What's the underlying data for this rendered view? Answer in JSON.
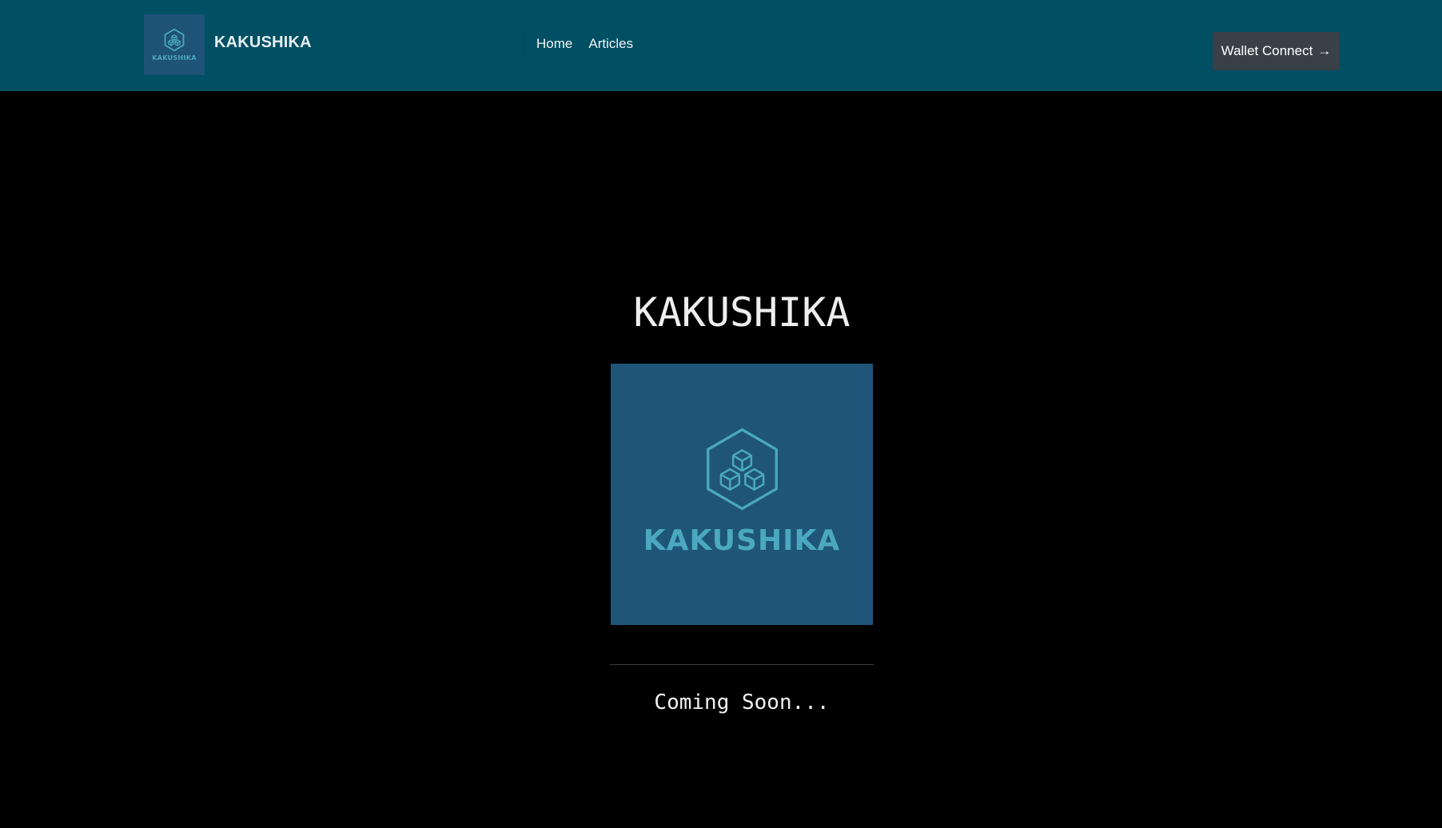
{
  "header": {
    "brand_name": "KAKUSHIKA",
    "logo_text": "KAKUSHIKA",
    "logo_icon": "hexagon-cubes-icon",
    "nav": [
      {
        "label": "Home"
      },
      {
        "label": "Articles"
      }
    ],
    "wallet_button": {
      "label": "Wallet Connect",
      "arrow": "→"
    }
  },
  "main": {
    "title": "KAKUSHIKA",
    "logo_text": "KAKUSHIKA",
    "logo_icon": "hexagon-cubes-icon",
    "status": "Coming Soon..."
  },
  "colors": {
    "header_bg": "#004f63",
    "logo_bg": "#1f5579",
    "logo_accent": "#4aa8c0",
    "button_bg": "#3a4047",
    "page_bg": "#000000"
  }
}
